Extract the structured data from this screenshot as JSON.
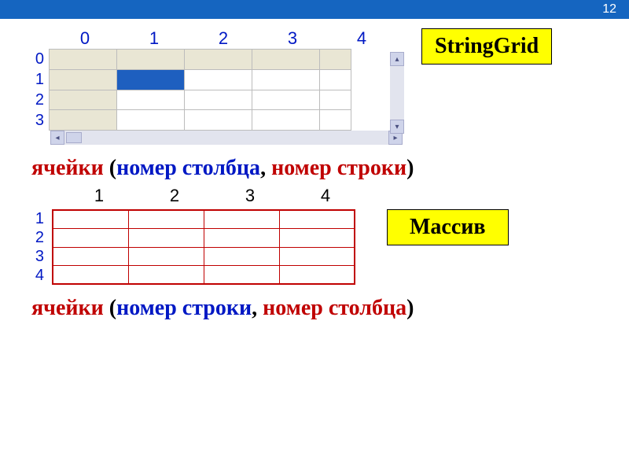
{
  "header": {
    "page_number": "12"
  },
  "stringgrid": {
    "label": "StringGrid",
    "col_headers": [
      "0",
      "1",
      "2",
      "3",
      "4"
    ],
    "row_headers": [
      "0",
      "1",
      "2",
      "3"
    ],
    "selected_cell": {
      "row": 1,
      "col": 1
    }
  },
  "formula_sg": {
    "word_cells": "ячейки",
    "paren_open": " (",
    "col_phrase": "номер столбца",
    "comma": ", ",
    "row_phrase": "номер строки",
    "paren_close": ")"
  },
  "array": {
    "label": "Массив",
    "col_headers": [
      "1",
      "2",
      "3",
      "4"
    ],
    "row_headers": [
      "1",
      "2",
      "3",
      "4"
    ]
  },
  "formula_arr": {
    "word_cells": "ячейки",
    "paren_open": " (",
    "row_phrase": "номер строки",
    "comma": ", ",
    "col_phrase": "номер столбца",
    "paren_close": ")"
  }
}
